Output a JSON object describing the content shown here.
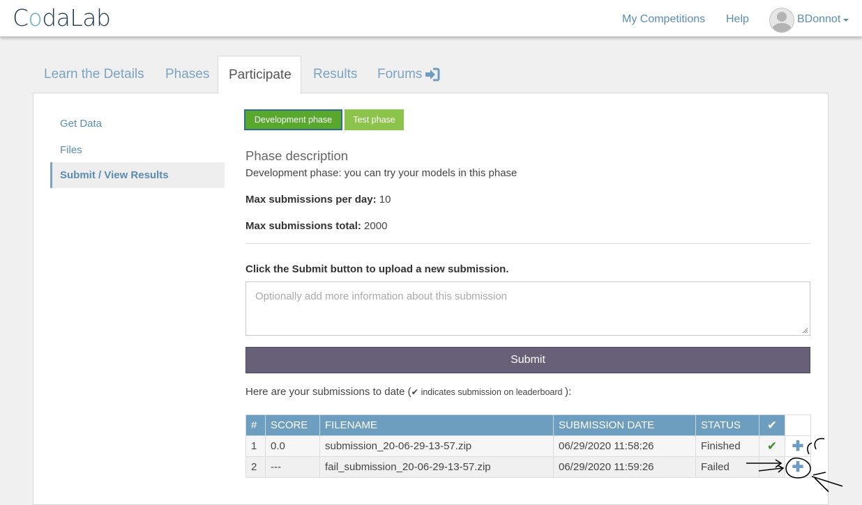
{
  "header": {
    "logo_prefix": "C",
    "logo_o": "o",
    "logo_suffix": "daLab",
    "nav": [
      "My Competitions",
      "Help"
    ],
    "username": "BDonnot"
  },
  "tabs": {
    "learn": "Learn the Details",
    "phases": "Phases",
    "participate": "Participate",
    "results": "Results",
    "forums": "Forums",
    "active": "Participate"
  },
  "sidebar": {
    "items": [
      "Get Data",
      "Files",
      "Submit / View Results"
    ],
    "active": "Submit / View Results"
  },
  "phases": {
    "buttons": [
      "Development phase",
      "Test phase"
    ],
    "selected": "Development phase"
  },
  "phase_info": {
    "title": "Phase description",
    "description": "Development phase: you can try your models in this phase",
    "max_per_day_label": "Max submissions per day:",
    "max_per_day": "10",
    "max_total_label": "Max submissions total:",
    "max_total": "2000"
  },
  "submit": {
    "instruction": "Click the Submit button to upload a new submission.",
    "placeholder": "Optionally add more information about this submission",
    "button_label": "Submit"
  },
  "submissions": {
    "intro": "Here are your submissions to date (",
    "intro_note": "indicates submission on leaderboard",
    "intro_end": "):",
    "columns": [
      "#",
      "SCORE",
      "FILENAME",
      "SUBMISSION DATE",
      "STATUS"
    ],
    "rows": [
      {
        "num": "1",
        "score": "0.0",
        "filename": "submission_20-06-29-13-57.zip",
        "date": "06/29/2020 11:58:26",
        "status": "Finished",
        "on_leaderboard": true
      },
      {
        "num": "2",
        "score": "---",
        "filename": "fail_submission_20-06-29-13-57.zip",
        "date": "06/29/2020 11:59:26",
        "status": "Failed",
        "on_leaderboard": false
      }
    ]
  },
  "colors": {
    "accent": "#5c8bb2",
    "table_header": "#6d9ec0",
    "phase_dev": "#58a82e",
    "phase_test": "#8cc34a",
    "submit_button": "#676078"
  },
  "icons": {
    "forums": "sign-in-icon",
    "leaderboard": "checkmark-icon",
    "row_detail": "plus-icon"
  }
}
